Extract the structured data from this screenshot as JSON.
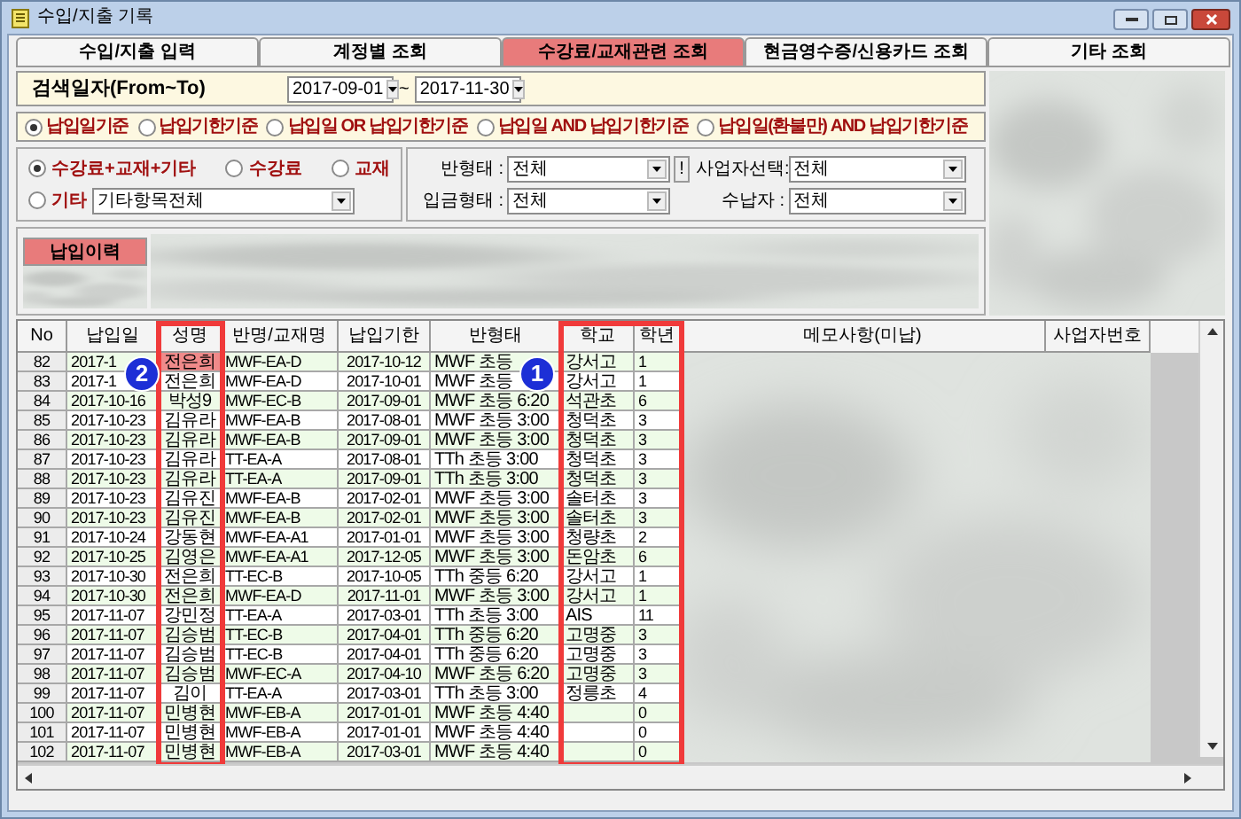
{
  "window": {
    "title": "수입/지출 기록"
  },
  "tabs": [
    {
      "label": "수입/지출 입력",
      "selected": false
    },
    {
      "label": "계정별 조회",
      "selected": false
    },
    {
      "label": "수강료/교재관련 조회",
      "selected": true
    },
    {
      "label": "현금영수증/신용카드 조회",
      "selected": false
    },
    {
      "label": "기타 조회",
      "selected": false
    }
  ],
  "search": {
    "label": "검색일자(From~To)",
    "from": "2017-09-01",
    "separator": "~",
    "to": "2017-11-30"
  },
  "date_basis": [
    {
      "label": "납입일기준",
      "selected": true
    },
    {
      "label": "납입기한기준",
      "selected": false
    },
    {
      "label": "납입일 OR 납입기한기준",
      "selected": false
    },
    {
      "label": "납입일 AND 납입기한기준",
      "selected": false
    },
    {
      "label": "납입일(환불만) AND 납입기한기준",
      "selected": false
    }
  ],
  "category": [
    {
      "label": "수강료+교재+기타",
      "selected": true
    },
    {
      "label": "수강료",
      "selected": false
    },
    {
      "label": "교재",
      "selected": false
    },
    {
      "label": "기타",
      "selected": false,
      "value": "기타항목전체"
    }
  ],
  "filters": [
    {
      "label": "반형태 :",
      "value": "전체",
      "button": "!"
    },
    {
      "label": "사업자선택:",
      "value": "전체"
    },
    {
      "label": "입금형태 :",
      "value": "전체"
    },
    {
      "label": "수납자 :",
      "value": "전체"
    }
  ],
  "history_button": {
    "label": "납입이력"
  },
  "table": {
    "columns": [
      {
        "label": "No",
        "highlighted": false
      },
      {
        "label": "납입일",
        "highlighted": false
      },
      {
        "label": "성명",
        "highlighted": true
      },
      {
        "label": "반명/교재명",
        "highlighted": false
      },
      {
        "label": "납입기한",
        "highlighted": false
      },
      {
        "label": "반형태",
        "highlighted": false
      },
      {
        "label": "학교",
        "highlighted": true
      },
      {
        "label": "학년",
        "highlighted": true
      },
      {
        "label": "메모사항(미납)",
        "highlighted": false
      },
      {
        "label": "사업자번호",
        "highlighted": false
      }
    ],
    "rows": [
      {
        "selected": true,
        "cells": [
          "82",
          "2017-1",
          "전은희",
          "MWF-EA-D",
          "2017-10-12",
          "MWF 초등",
          "강서고",
          "1"
        ]
      },
      {
        "selected": false,
        "cells": [
          "83",
          "2017-1",
          "전은희",
          "MWF-EA-D",
          "2017-10-01",
          "MWF 초등",
          "강서고",
          "1"
        ]
      },
      {
        "selected": false,
        "cells": [
          "84",
          "2017-10-16",
          "박성9",
          "MWF-EC-B",
          "2017-09-01",
          "MWF 초등 6:20",
          "석관초",
          "6"
        ]
      },
      {
        "selected": false,
        "cells": [
          "85",
          "2017-10-23",
          "김유라",
          "MWF-EA-B",
          "2017-08-01",
          "MWF 초등 3:00",
          "청덕초",
          "3"
        ]
      },
      {
        "selected": false,
        "cells": [
          "86",
          "2017-10-23",
          "김유라",
          "MWF-EA-B",
          "2017-09-01",
          "MWF 초등 3:00",
          "청덕초",
          "3"
        ]
      },
      {
        "selected": false,
        "cells": [
          "87",
          "2017-10-23",
          "김유라",
          "TT-EA-A",
          "2017-08-01",
          "TTh 초등 3:00",
          "청덕초",
          "3"
        ]
      },
      {
        "selected": false,
        "cells": [
          "88",
          "2017-10-23",
          "김유라",
          "TT-EA-A",
          "2017-09-01",
          "TTh 초등 3:00",
          "청덕초",
          "3"
        ]
      },
      {
        "selected": false,
        "cells": [
          "89",
          "2017-10-23",
          "김유진",
          "MWF-EA-B",
          "2017-02-01",
          "MWF 초등 3:00",
          "솔터초",
          "3"
        ]
      },
      {
        "selected": false,
        "cells": [
          "90",
          "2017-10-23",
          "김유진",
          "MWF-EA-B",
          "2017-02-01",
          "MWF 초등 3:00",
          "솔터초",
          "3"
        ]
      },
      {
        "selected": false,
        "cells": [
          "91",
          "2017-10-24",
          "강동현",
          "MWF-EA-A1",
          "2017-01-01",
          "MWF 초등 3:00",
          "청량초",
          "2"
        ]
      },
      {
        "selected": false,
        "cells": [
          "92",
          "2017-10-25",
          "김영은",
          "MWF-EA-A1",
          "2017-12-05",
          "MWF 초등 3:00",
          "돈암초",
          "6"
        ]
      },
      {
        "selected": false,
        "cells": [
          "93",
          "2017-10-30",
          "전은희",
          "TT-EC-B",
          "2017-10-05",
          "TTh 중등 6:20",
          "강서고",
          "1"
        ]
      },
      {
        "selected": false,
        "cells": [
          "94",
          "2017-10-30",
          "전은희",
          "MWF-EA-D",
          "2017-11-01",
          "MWF 초등 3:00",
          "강서고",
          "1"
        ]
      },
      {
        "selected": false,
        "cells": [
          "95",
          "2017-11-07",
          "강민정",
          "TT-EA-A",
          "2017-03-01",
          "TTh 초등 3:00",
          "AIS",
          "11"
        ]
      },
      {
        "selected": false,
        "cells": [
          "96",
          "2017-11-07",
          "김승범",
          "TT-EC-B",
          "2017-04-01",
          "TTh 중등 6:20",
          "고명중",
          "3"
        ]
      },
      {
        "selected": false,
        "cells": [
          "97",
          "2017-11-07",
          "김승범",
          "TT-EC-B",
          "2017-04-01",
          "TTh 중등 6:20",
          "고명중",
          "3"
        ]
      },
      {
        "selected": false,
        "cells": [
          "98",
          "2017-11-07",
          "김승범",
          "MWF-EC-A",
          "2017-04-10",
          "MWF 초등 6:20",
          "고명중",
          "3"
        ]
      },
      {
        "selected": false,
        "cells": [
          "99",
          "2017-11-07",
          "김이",
          "TT-EA-A",
          "2017-03-01",
          "TTh 초등 3:00",
          "정릉초",
          "4"
        ]
      },
      {
        "selected": false,
        "cells": [
          "100",
          "2017-11-07",
          "민병현",
          "MWF-EB-A",
          "2017-01-01",
          "MWF 초등 4:40",
          "",
          "0"
        ]
      },
      {
        "selected": false,
        "cells": [
          "101",
          "2017-11-07",
          "민병현",
          "MWF-EB-A",
          "2017-01-01",
          "MWF 초등 4:40",
          "",
          "0"
        ]
      },
      {
        "selected": false,
        "cells": [
          "102",
          "2017-11-07",
          "민병현",
          "MWF-EB-A",
          "2017-03-01",
          "MWF 초등 4:40",
          "",
          "0"
        ]
      }
    ]
  },
  "annotations": [
    {
      "label": "2"
    },
    {
      "label": "1"
    }
  ]
}
